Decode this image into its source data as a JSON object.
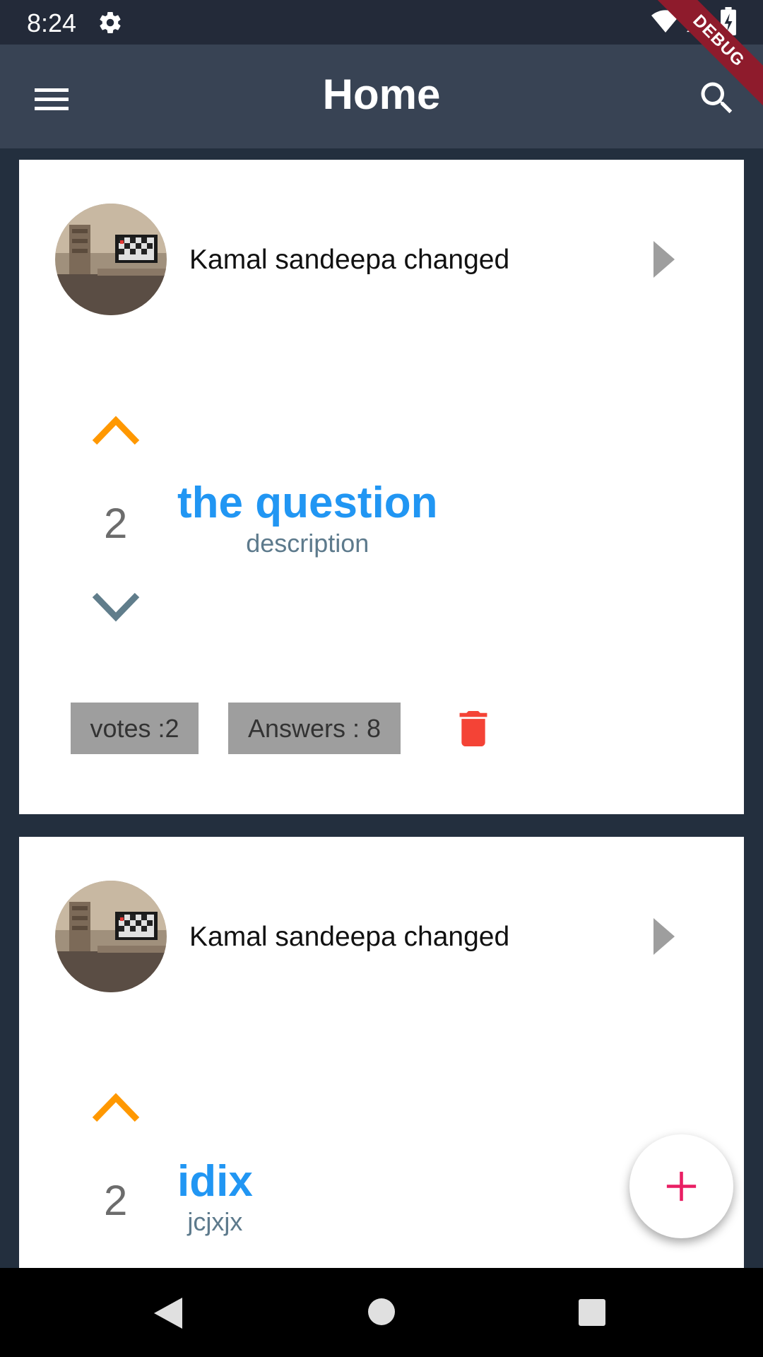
{
  "status_bar": {
    "time": "8:24"
  },
  "debug_banner": "DEBUG",
  "app_bar": {
    "title": "Home"
  },
  "questions": [
    {
      "author": "Kamal sandeepa changed",
      "votes": "2",
      "title": "the question",
      "description": "description",
      "votes_chip": "votes :2",
      "answers_chip": "Answers : 8"
    },
    {
      "author": "Kamal sandeepa changed",
      "votes": "2",
      "title": "idix",
      "description": "jcjxjx"
    }
  ],
  "colors": {
    "app_bar": "#384354",
    "background": "#232f3e",
    "title_blue": "#2196f3",
    "upvote_orange": "#ff9800",
    "downvote_grey": "#607d8b",
    "delete_red": "#f44336",
    "fab_plus": "#e91e63"
  },
  "icons": {
    "menu": "menu-icon",
    "search": "search-icon",
    "upvote": "chevron-up-icon",
    "downvote": "chevron-down-icon",
    "open": "play-arrow-icon",
    "delete": "trash-icon",
    "add": "plus-icon"
  }
}
